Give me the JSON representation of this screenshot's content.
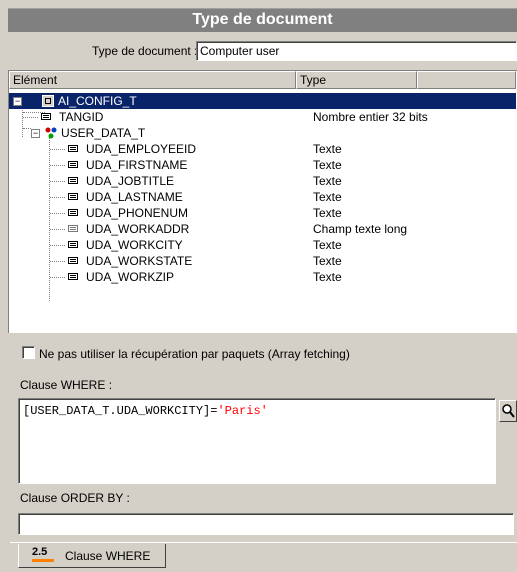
{
  "title": "Type de document",
  "doc_type": {
    "label": "Type de document :",
    "value": "Computer user"
  },
  "columns": {
    "element": "Elément",
    "type": "Type"
  },
  "tree": {
    "root": {
      "label": "AI_CONFIG_T",
      "selected": true
    },
    "rows": [
      {
        "label": "TANGID",
        "type": "Nombre entier 32 bits",
        "icon": "field-icon"
      },
      {
        "label": "USER_DATA_T",
        "type": "",
        "icon": "link-table-icon"
      },
      {
        "label": "UDA_EMPLOYEEID",
        "type": "Texte",
        "icon": "field-icon"
      },
      {
        "label": "UDA_FIRSTNAME",
        "type": "Texte",
        "icon": "field-icon"
      },
      {
        "label": "UDA_JOBTITLE",
        "type": "Texte",
        "icon": "field-icon"
      },
      {
        "label": "UDA_LASTNAME",
        "type": "Texte",
        "icon": "field-icon"
      },
      {
        "label": "UDA_PHONENUM",
        "type": "Texte",
        "icon": "field-icon"
      },
      {
        "label": "UDA_WORKADDR",
        "type": "Champ texte long",
        "icon": "long-text-icon"
      },
      {
        "label": "UDA_WORKCITY",
        "type": "Texte",
        "icon": "field-icon"
      },
      {
        "label": "UDA_WORKSTATE",
        "type": "Texte",
        "icon": "field-icon"
      },
      {
        "label": "UDA_WORKZIP",
        "type": "Texte",
        "icon": "field-icon"
      }
    ]
  },
  "array_fetching": {
    "label": "Ne pas utiliser la récupération par paquets (Array fetching)",
    "checked": false
  },
  "where": {
    "label": "Clause WHERE :",
    "part1": "[USER_DATA_T.UDA_WORKCITY]",
    "op": "=",
    "literal": "'Paris'"
  },
  "order_by": {
    "label": "Clause ORDER BY :",
    "value": ""
  },
  "tab": {
    "label": "Clause WHERE",
    "icon_text": "2.5"
  },
  "colors": {
    "selection": "#0a246a",
    "literal": "#ff0000",
    "title_bar": "#808080"
  }
}
